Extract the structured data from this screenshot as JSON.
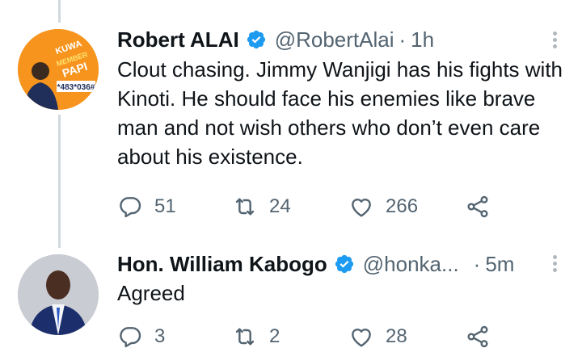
{
  "tweets": [
    {
      "name": "Robert ALAI",
      "handle": "@RobertAlai",
      "dot": "·",
      "time": "1h",
      "text": "Clout chasing. Jimmy Wanjigi has his fights with Kinoti. He should face his enemies like brave man and not wish others who don’t even care about his existence.",
      "avatar": {
        "banner_line1": "KUWA",
        "banner_line2": "MEMBER",
        "banner_line3": "PAPI",
        "code": "*483*036#"
      },
      "replies": "51",
      "retweets": "24",
      "likes": "266"
    },
    {
      "name": "Hon. William Kabogo",
      "handle": "@honka...",
      "dot": "·",
      "time": "5m",
      "text": "Agreed",
      "replies": "3",
      "retweets": "2",
      "likes": "28"
    }
  ],
  "colors": {
    "verified": "#1d9bf0",
    "avatar1_bg": "#f7941d",
    "thread_line": "#cfd9de"
  },
  "icons": [
    "reply-icon",
    "retweet-icon",
    "like-icon",
    "share-icon",
    "verified-badge-icon",
    "more-icon"
  ]
}
